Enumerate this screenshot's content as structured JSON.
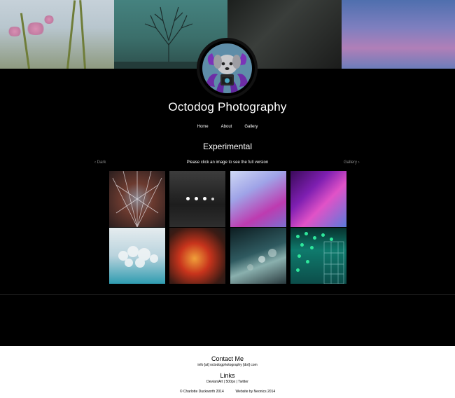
{
  "site": {
    "title": "Octodog Photography"
  },
  "nav": {
    "items": [
      "Home",
      "About",
      "Gallery"
    ]
  },
  "gallery_page": {
    "section_title": "Experimental",
    "prev_link": "‹ Dark",
    "hint": "Please click an image to see the full version",
    "next_link": "Gallery ›",
    "thumbnails": 8
  },
  "footer": {
    "contact_heading": "Contact Me",
    "contact_email": "info [at] octodogphotography [dot] com",
    "links_heading": "Links",
    "links": [
      "DeviantArt",
      "500px",
      "Twitter"
    ],
    "links_separator": " | ",
    "copyright": "© Charlotte Duckworth 2014",
    "credit": "Website by Neonics 2014"
  },
  "colors": {
    "background": "#000000",
    "footer_background": "#ffffff",
    "link_muted": "#888888"
  }
}
